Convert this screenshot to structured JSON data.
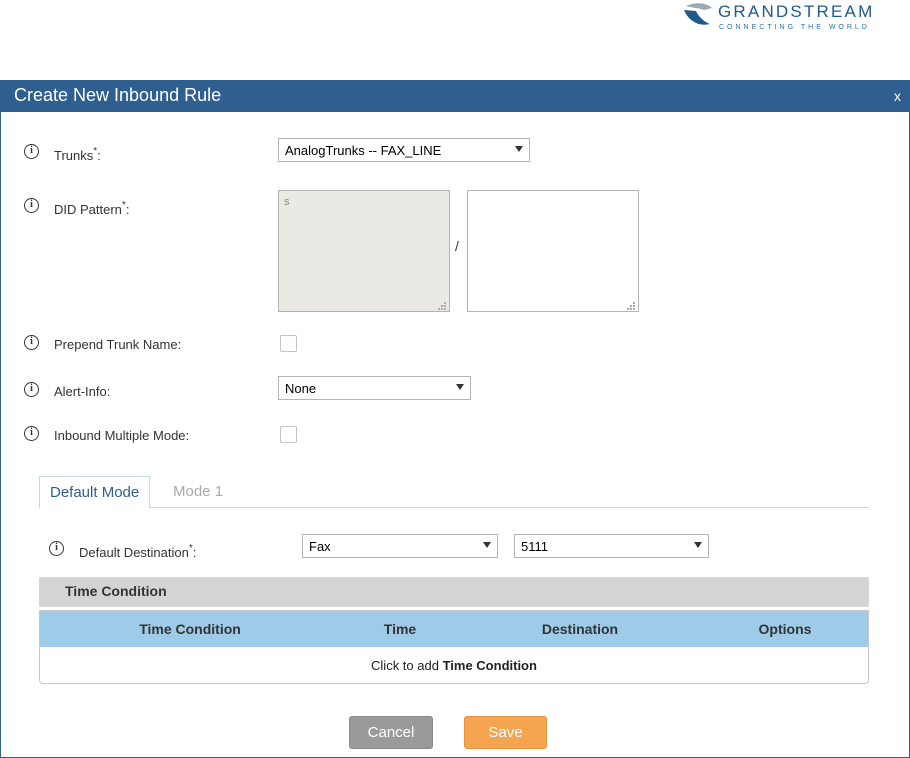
{
  "brand": {
    "name": "GRANDSTREAM",
    "tagline": "CONNECTING THE WORLD",
    "colors": {
      "primary": "#2f5f8e",
      "logo_gray": "#8a9aa8",
      "logo_blue": "#1f5a8c"
    }
  },
  "dialog": {
    "title": "Create New Inbound Rule",
    "close_label": "x"
  },
  "fields": {
    "trunks": {
      "label": "Trunks",
      "required_mark": "*",
      "suffix": ":",
      "value": "AnalogTrunks -- FAX_LINE"
    },
    "did_pattern": {
      "label": "DID Pattern",
      "required_mark": "*",
      "suffix": ":",
      "left_value": "s",
      "separator": "/",
      "right_value": ""
    },
    "prepend_trunk_name": {
      "label": "Prepend Trunk Name:",
      "checked": false
    },
    "alert_info": {
      "label": "Alert-Info:",
      "value": "None"
    },
    "inbound_multiple_mode": {
      "label": "Inbound Multiple Mode:",
      "checked": false
    }
  },
  "tabs": [
    {
      "label": "Default Mode",
      "active": true
    },
    {
      "label": "Mode 1",
      "active": false
    }
  ],
  "default_destination": {
    "label": "Default Destination",
    "required_mark": "*",
    "suffix": ":",
    "type_value": "Fax",
    "target_value": "5111"
  },
  "time_condition": {
    "section_title": "Time Condition",
    "columns": [
      "Time Condition",
      "Time",
      "Destination",
      "Options"
    ],
    "add_prefix": "Click to add ",
    "add_bold": "Time Condition"
  },
  "buttons": {
    "cancel": "Cancel",
    "save": "Save"
  },
  "colors": {
    "table_header": "#9dcbe8",
    "section_bar": "#d4d4d4",
    "save_button": "#f5a550",
    "cancel_button": "#9a9a9a"
  }
}
